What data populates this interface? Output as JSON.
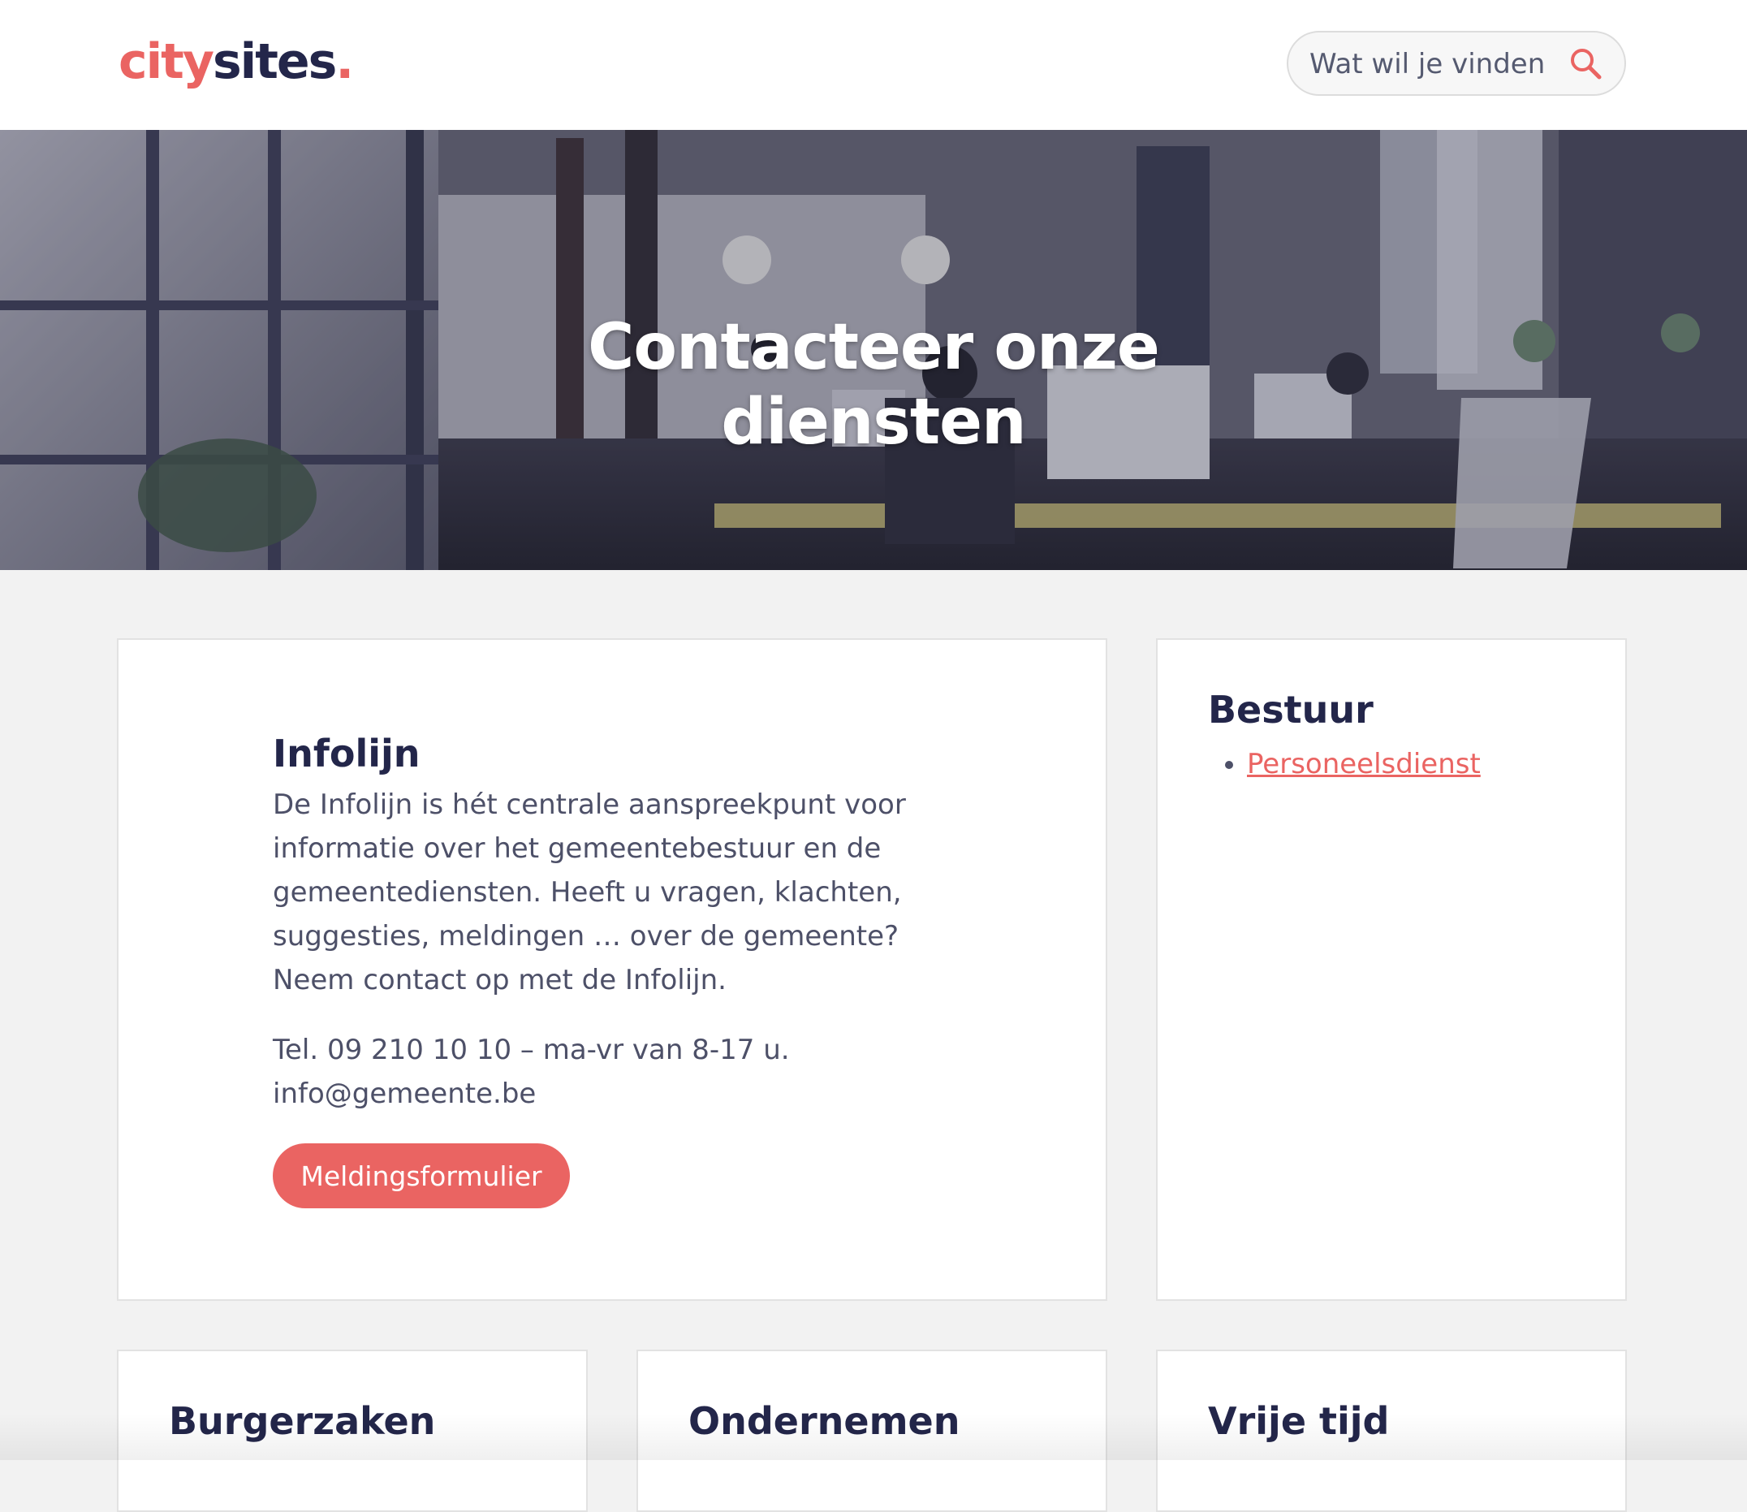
{
  "header": {
    "logo": {
      "city": "city",
      "sites": "sites",
      "dot": "."
    },
    "search": {
      "placeholder": "Wat wil je vinden",
      "icon": "search-icon"
    }
  },
  "hero": {
    "title": "Contacteer onze diensten"
  },
  "infolijn": {
    "title": "Infolijn",
    "description": "De Infolijn is hét centrale aanspreekpunt voor informatie over het gemeentebestuur en de gemeentediensten. Heeft u vragen, klachten, suggesties, meldingen … over de gemeente? Neem contact op met de Infolijn.",
    "phone": "Tel. 09 210 10 10 – ma-vr van 8-17 u.",
    "email": "info@gemeente.be",
    "button_label": "Meldingsformulier"
  },
  "bestuur": {
    "title": "Bestuur",
    "links": [
      "Personeelsdienst"
    ]
  },
  "categories": [
    {
      "title": "Burgerzaken"
    },
    {
      "title": "Ondernemen"
    },
    {
      "title": "Vrije tijd"
    }
  ],
  "colors": {
    "accent": "#ea6462",
    "navy": "#23264a",
    "text": "#4d5068",
    "background": "#f2f2f2"
  }
}
